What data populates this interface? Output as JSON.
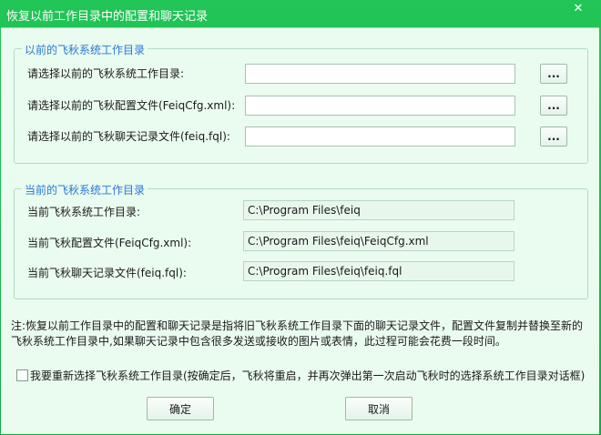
{
  "window": {
    "title": "恢复以前工作目录中的配置和聊天记录",
    "close_glyph": "✕"
  },
  "previous_group": {
    "title": "以前的飞秋系统工作目录",
    "rows": [
      {
        "label": "请选择以前的飞秋系统工作目录:",
        "value": "",
        "browse_label": "..."
      },
      {
        "label": "请选择以前的飞秋配置文件(FeiqCfg.xml):",
        "value": "",
        "browse_label": "..."
      },
      {
        "label": "请选择以前的飞秋聊天记录文件(feiq.fql):",
        "value": "",
        "browse_label": "..."
      }
    ]
  },
  "current_group": {
    "title": "当前的飞秋系统工作目录",
    "rows": [
      {
        "label": "当前飞秋系统工作目录:",
        "value": "C:\\Program Files\\feiq"
      },
      {
        "label": "当前飞秋配置文件(FeiqCfg.xml):",
        "value": "C:\\Program Files\\feiq\\FeiqCfg.xml"
      },
      {
        "label": "当前飞秋聊天记录文件(feiq.fql):",
        "value": "C:\\Program Files\\feiq\\feiq.fql"
      }
    ]
  },
  "note": "注:恢复以前工作目录中的配置和聊天记录是指将旧飞秋系统工作目录下面的聊天记录文件，配置文件复制并替换至新的飞秋系统工作目录中,如果聊天记录中包含很多发送或接收的图片或表情，此过程可能会花费一段时间。",
  "reselect": {
    "checked": false,
    "label": "我要重新选择飞秋系统工作目录(按确定后，飞秋将重启，并再次弹出第一次启动飞秋时的选择系统工作目录对话框)"
  },
  "buttons": {
    "ok_label": "确定",
    "cancel_label": "取消"
  },
  "colors": {
    "frame": "#19b84a",
    "client_bg": "#eafbef",
    "group_title": "#2a78d8"
  }
}
